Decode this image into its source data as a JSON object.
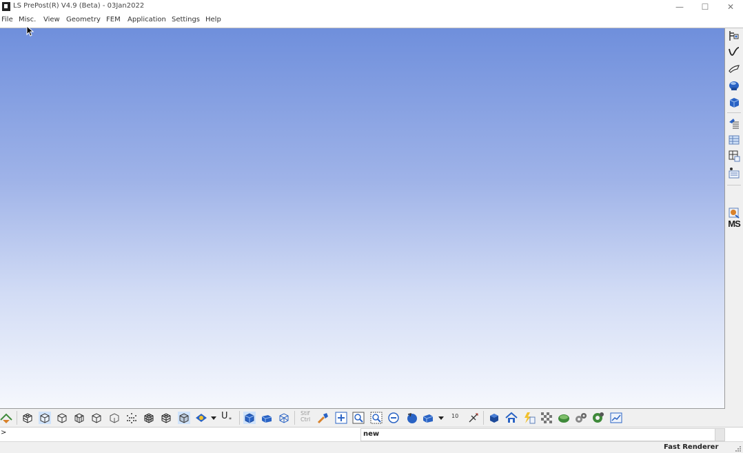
{
  "window": {
    "title": "LS PrePost(R) V4.9 (Beta) - 03Jan2022",
    "controls": {
      "minimize": "—",
      "maximize": "☐",
      "close": "✕"
    }
  },
  "menu": {
    "items": [
      {
        "label": "File"
      },
      {
        "label": "Misc."
      },
      {
        "label": "View"
      },
      {
        "label": "Geometry"
      },
      {
        "label": "FEM"
      },
      {
        "label": "Application"
      },
      {
        "label": "Settings"
      },
      {
        "label": "Help"
      }
    ]
  },
  "viewport": {
    "gradient_top": "#6f8fdc",
    "gradient_bottom": "#f6f8fd"
  },
  "right_toolbar": {
    "icons": [
      "create-entity-icon",
      "curve-icon",
      "surface-icon",
      "solid-icon",
      "block-mesher-icon",
      "element-tools-icon",
      "model-tree-icon",
      "mesh-edit-icon",
      "keyword-manager-icon",
      "ms-text-icon",
      "post-results-icon"
    ],
    "ms_label": "MS"
  },
  "bottom_toolbar": {
    "icons": [
      "home-model-icon",
      "render-shaded-icon",
      "render-solid-icon",
      "render-wireframe-icon",
      "render-hidden-icon",
      "render-outline-icon",
      "render-feature-icon",
      "render-nodes-icon",
      "render-mesh-icon",
      "render-transparent-icon",
      "render-shrink-icon",
      "render-color-icon",
      "dropdown-arrow-icon",
      "u-star-icon",
      "view-iso-icon",
      "view-front-icon",
      "view-cube-icon",
      "stiff-ctrl-icon",
      "pick-tool-icon",
      "zoom-in-icon",
      "zoom-window-icon",
      "zoom-area-icon",
      "zoom-out-icon",
      "rotate-icon",
      "view-orient-icon",
      "dropdown-arrow-icon",
      "axis-icon",
      "cube-blue-icon",
      "house-icon",
      "lightning-icon",
      "checker-icon",
      "disk-icon",
      "gears-icon",
      "settings-gear-icon",
      "graph-icon"
    ],
    "stiff_label_1": "Stif",
    "stiff_label_2": "Ctrl",
    "speed_label": "10",
    "u_label": "U"
  },
  "command": {
    "prompt": ">",
    "input_value": "",
    "status_text": "new"
  },
  "statusbar": {
    "renderer": "Fast Renderer"
  },
  "colors": {
    "icon_blue": "#2a63c4",
    "icon_dark": "#3a3a3a",
    "icon_green": "#3f8a3a",
    "icon_orange": "#d9822b"
  }
}
